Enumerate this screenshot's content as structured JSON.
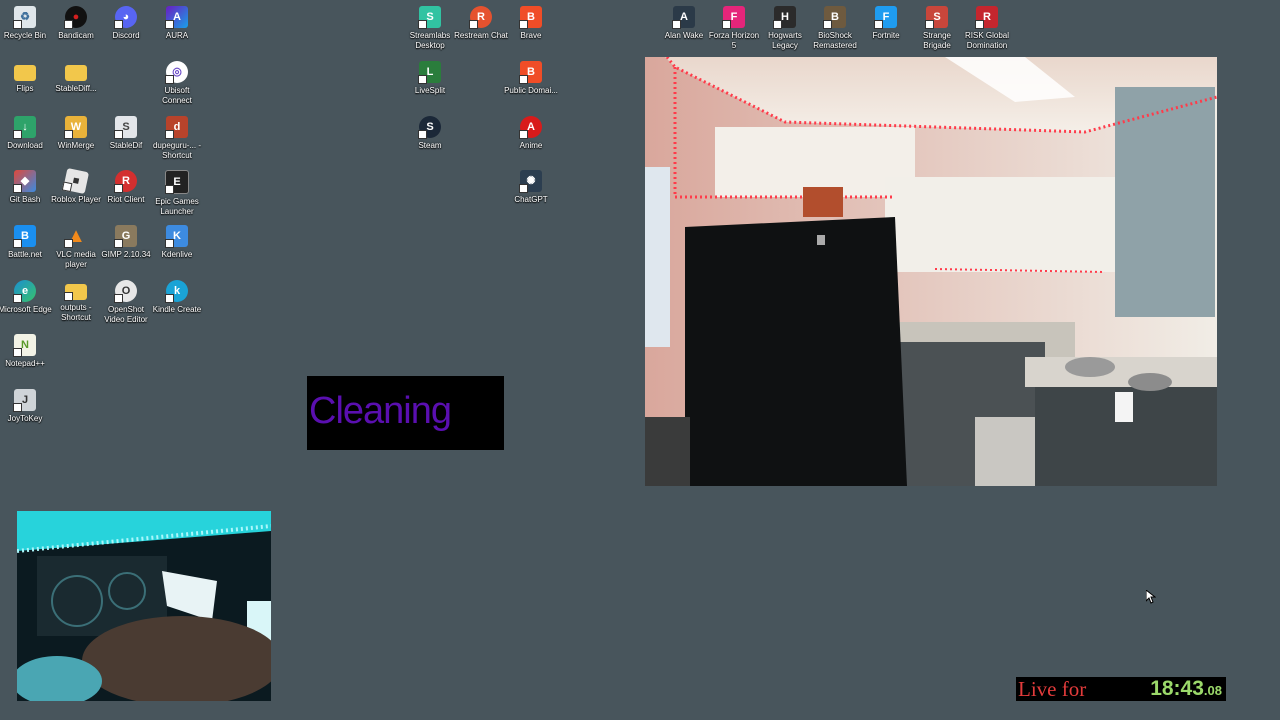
{
  "desktop": {
    "icons": [
      {
        "label": "Recycle Bin",
        "glyph": "♻",
        "color": "#dfe6ea"
      },
      {
        "label": "Bandicam",
        "glyph": "●",
        "color": "#d21f1f"
      },
      {
        "label": "Discord",
        "glyph": "◕",
        "color": "#5865f2"
      },
      {
        "label": "AURA",
        "glyph": "A",
        "color": "#7a2cc0"
      },
      {
        "label": "Flips",
        "glyph": "",
        "color": "#f2c74b"
      },
      {
        "label": "StableDiff...",
        "glyph": "",
        "color": "#f2c74b"
      },
      {
        "label": "Ubisoft Connect",
        "glyph": "◎",
        "color": "#6b4bc8"
      },
      {
        "label": "Download",
        "glyph": "↓",
        "color": "#2ea36a"
      },
      {
        "label": "WinMerge",
        "glyph": "W",
        "color": "#e9b23a"
      },
      {
        "label": "StableDif",
        "glyph": "S",
        "color": "#e3e6ea"
      },
      {
        "label": "dupeguru-... - Shortcut",
        "glyph": "d",
        "color": "#b8432b"
      },
      {
        "label": "Git Bash",
        "glyph": "◆",
        "color": "#e0483b"
      },
      {
        "label": "Roblox Player",
        "glyph": "■",
        "color": "#e6e6e6"
      },
      {
        "label": "Riot Client",
        "glyph": "R",
        "color": "#d32f2f"
      },
      {
        "label": "Epic Games Launcher",
        "glyph": "E",
        "color": "#222222"
      },
      {
        "label": "Battle.net",
        "glyph": "B",
        "color": "#1a8ff0"
      },
      {
        "label": "VLC media player",
        "glyph": "▲",
        "color": "#f28a1b"
      },
      {
        "label": "GIMP 2.10.34",
        "glyph": "G",
        "color": "#8a7a5e"
      },
      {
        "label": "Kdenlive",
        "glyph": "K",
        "color": "#3d8be0"
      },
      {
        "label": "Microsoft Edge",
        "glyph": "e",
        "color": "#1b8fd1"
      },
      {
        "label": "outputs - Shortcut",
        "glyph": "",
        "color": "#f2c74b"
      },
      {
        "label": "OpenShot Video Editor",
        "glyph": "O",
        "color": "#e7e7e7"
      },
      {
        "label": "Kindle Create",
        "glyph": "k",
        "color": "#1aa3d6"
      },
      {
        "label": "Notepad++",
        "glyph": "N",
        "color": "#97c95a"
      },
      {
        "label": "JoyToKey",
        "glyph": "J",
        "color": "#cfd4d8"
      },
      {
        "label": "Streamlabs Desktop",
        "glyph": "S",
        "color": "#31c3a2"
      },
      {
        "label": "Restream Chat",
        "glyph": "R",
        "color": "#e5522f"
      },
      {
        "label": "Brave",
        "glyph": "B",
        "color": "#f04d27"
      },
      {
        "label": "LiveSplit",
        "glyph": "L",
        "color": "#2a7d3c"
      },
      {
        "label": "Public Domai...",
        "glyph": "B",
        "color": "#f04d27"
      },
      {
        "label": "Steam",
        "glyph": "S",
        "color": "#1b2838"
      },
      {
        "label": "Anime",
        "glyph": "A",
        "color": "#d81b1b"
      },
      {
        "label": "ChatGPT",
        "glyph": "✺",
        "color": "#2c3e50"
      },
      {
        "label": "Alan Wake",
        "glyph": "A",
        "color": "#2b3a48"
      },
      {
        "label": "Forza Horizon 5",
        "glyph": "F",
        "color": "#e5257a"
      },
      {
        "label": "Hogwarts Legacy",
        "glyph": "H",
        "color": "#2b2b2b"
      },
      {
        "label": "BioShock Remastered",
        "glyph": "B",
        "color": "#6e5a3f"
      },
      {
        "label": "Fortnite",
        "glyph": "F",
        "color": "#1f9cf0"
      },
      {
        "label": "Strange Brigade",
        "glyph": "S",
        "color": "#c8463b"
      },
      {
        "label": "RISK Global Domination",
        "glyph": "R",
        "color": "#c4262e"
      }
    ]
  },
  "overlay": {
    "cleaning_text": "Cleaning",
    "live_label": "Live for",
    "live_time": "18:43",
    "live_fraction": ".08"
  }
}
